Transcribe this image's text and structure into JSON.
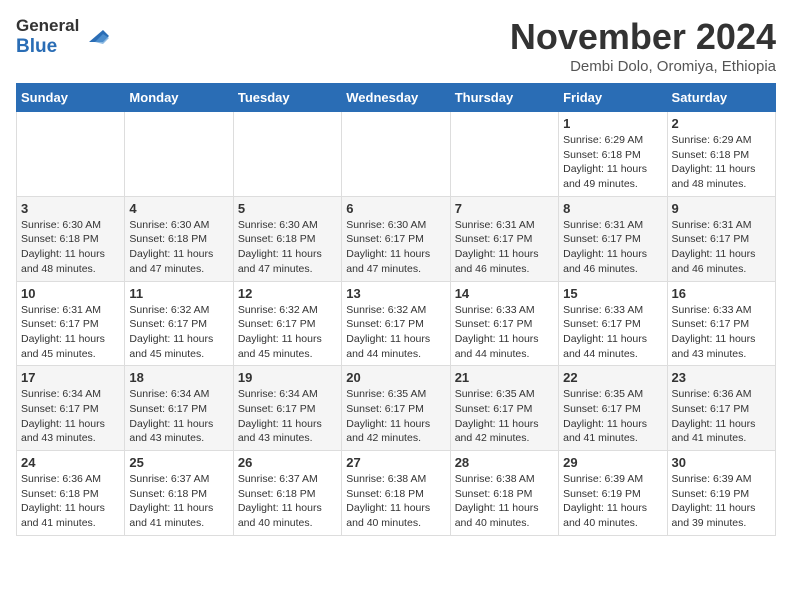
{
  "header": {
    "logo_line1": "General",
    "logo_line2": "Blue",
    "month_title": "November 2024",
    "subtitle": "Dembi Dolo, Oromiya, Ethiopia"
  },
  "calendar": {
    "days_of_week": [
      "Sunday",
      "Monday",
      "Tuesday",
      "Wednesday",
      "Thursday",
      "Friday",
      "Saturday"
    ],
    "weeks": [
      [
        {
          "day": "",
          "info": ""
        },
        {
          "day": "",
          "info": ""
        },
        {
          "day": "",
          "info": ""
        },
        {
          "day": "",
          "info": ""
        },
        {
          "day": "",
          "info": ""
        },
        {
          "day": "1",
          "info": "Sunrise: 6:29 AM\nSunset: 6:18 PM\nDaylight: 11 hours\nand 49 minutes."
        },
        {
          "day": "2",
          "info": "Sunrise: 6:29 AM\nSunset: 6:18 PM\nDaylight: 11 hours\nand 48 minutes."
        }
      ],
      [
        {
          "day": "3",
          "info": "Sunrise: 6:30 AM\nSunset: 6:18 PM\nDaylight: 11 hours\nand 48 minutes."
        },
        {
          "day": "4",
          "info": "Sunrise: 6:30 AM\nSunset: 6:18 PM\nDaylight: 11 hours\nand 47 minutes."
        },
        {
          "day": "5",
          "info": "Sunrise: 6:30 AM\nSunset: 6:18 PM\nDaylight: 11 hours\nand 47 minutes."
        },
        {
          "day": "6",
          "info": "Sunrise: 6:30 AM\nSunset: 6:17 PM\nDaylight: 11 hours\nand 47 minutes."
        },
        {
          "day": "7",
          "info": "Sunrise: 6:31 AM\nSunset: 6:17 PM\nDaylight: 11 hours\nand 46 minutes."
        },
        {
          "day": "8",
          "info": "Sunrise: 6:31 AM\nSunset: 6:17 PM\nDaylight: 11 hours\nand 46 minutes."
        },
        {
          "day": "9",
          "info": "Sunrise: 6:31 AM\nSunset: 6:17 PM\nDaylight: 11 hours\nand 46 minutes."
        }
      ],
      [
        {
          "day": "10",
          "info": "Sunrise: 6:31 AM\nSunset: 6:17 PM\nDaylight: 11 hours\nand 45 minutes."
        },
        {
          "day": "11",
          "info": "Sunrise: 6:32 AM\nSunset: 6:17 PM\nDaylight: 11 hours\nand 45 minutes."
        },
        {
          "day": "12",
          "info": "Sunrise: 6:32 AM\nSunset: 6:17 PM\nDaylight: 11 hours\nand 45 minutes."
        },
        {
          "day": "13",
          "info": "Sunrise: 6:32 AM\nSunset: 6:17 PM\nDaylight: 11 hours\nand 44 minutes."
        },
        {
          "day": "14",
          "info": "Sunrise: 6:33 AM\nSunset: 6:17 PM\nDaylight: 11 hours\nand 44 minutes."
        },
        {
          "day": "15",
          "info": "Sunrise: 6:33 AM\nSunset: 6:17 PM\nDaylight: 11 hours\nand 44 minutes."
        },
        {
          "day": "16",
          "info": "Sunrise: 6:33 AM\nSunset: 6:17 PM\nDaylight: 11 hours\nand 43 minutes."
        }
      ],
      [
        {
          "day": "17",
          "info": "Sunrise: 6:34 AM\nSunset: 6:17 PM\nDaylight: 11 hours\nand 43 minutes."
        },
        {
          "day": "18",
          "info": "Sunrise: 6:34 AM\nSunset: 6:17 PM\nDaylight: 11 hours\nand 43 minutes."
        },
        {
          "day": "19",
          "info": "Sunrise: 6:34 AM\nSunset: 6:17 PM\nDaylight: 11 hours\nand 43 minutes."
        },
        {
          "day": "20",
          "info": "Sunrise: 6:35 AM\nSunset: 6:17 PM\nDaylight: 11 hours\nand 42 minutes."
        },
        {
          "day": "21",
          "info": "Sunrise: 6:35 AM\nSunset: 6:17 PM\nDaylight: 11 hours\nand 42 minutes."
        },
        {
          "day": "22",
          "info": "Sunrise: 6:35 AM\nSunset: 6:17 PM\nDaylight: 11 hours\nand 41 minutes."
        },
        {
          "day": "23",
          "info": "Sunrise: 6:36 AM\nSunset: 6:17 PM\nDaylight: 11 hours\nand 41 minutes."
        }
      ],
      [
        {
          "day": "24",
          "info": "Sunrise: 6:36 AM\nSunset: 6:18 PM\nDaylight: 11 hours\nand 41 minutes."
        },
        {
          "day": "25",
          "info": "Sunrise: 6:37 AM\nSunset: 6:18 PM\nDaylight: 11 hours\nand 41 minutes."
        },
        {
          "day": "26",
          "info": "Sunrise: 6:37 AM\nSunset: 6:18 PM\nDaylight: 11 hours\nand 40 minutes."
        },
        {
          "day": "27",
          "info": "Sunrise: 6:38 AM\nSunset: 6:18 PM\nDaylight: 11 hours\nand 40 minutes."
        },
        {
          "day": "28",
          "info": "Sunrise: 6:38 AM\nSunset: 6:18 PM\nDaylight: 11 hours\nand 40 minutes."
        },
        {
          "day": "29",
          "info": "Sunrise: 6:39 AM\nSunset: 6:19 PM\nDaylight: 11 hours\nand 40 minutes."
        },
        {
          "day": "30",
          "info": "Sunrise: 6:39 AM\nSunset: 6:19 PM\nDaylight: 11 hours\nand 39 minutes."
        }
      ]
    ]
  }
}
